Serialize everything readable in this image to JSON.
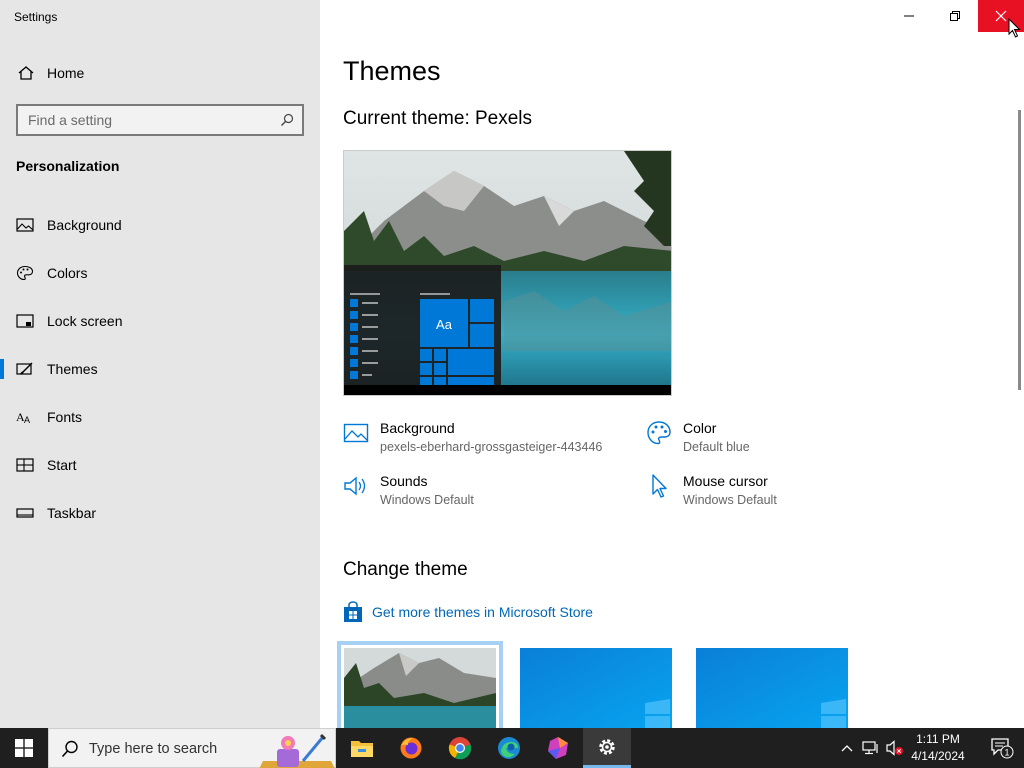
{
  "window": {
    "title": "Settings",
    "minimize_glyph": "—",
    "close_glyph": "✕"
  },
  "sidebar": {
    "home_label": "Home",
    "search_placeholder": "Find a setting",
    "section_title": "Personalization",
    "items": [
      {
        "label": "Background",
        "icon": "picture-icon"
      },
      {
        "label": "Colors",
        "icon": "palette-icon"
      },
      {
        "label": "Lock screen",
        "icon": "lock-screen-icon"
      },
      {
        "label": "Themes",
        "icon": "themes-icon",
        "active": true
      },
      {
        "label": "Fonts",
        "icon": "fonts-icon"
      },
      {
        "label": "Start",
        "icon": "start-icon"
      },
      {
        "label": "Taskbar",
        "icon": "taskbar-icon"
      }
    ]
  },
  "main": {
    "page_title": "Themes",
    "current_theme_label": "Current theme: Pexels",
    "preview_tile_text": "Aa",
    "properties": {
      "background": {
        "name": "Background",
        "value": "pexels-eberhard-grossgasteiger-443446"
      },
      "color": {
        "name": "Color",
        "value": "Default blue"
      },
      "sounds": {
        "name": "Sounds",
        "value": "Windows Default"
      },
      "mouse_cursor": {
        "name": "Mouse cursor",
        "value": "Windows Default"
      }
    },
    "change_theme_title": "Change theme",
    "store_link": "Get more themes in Microsoft Store"
  },
  "taskbar": {
    "search_placeholder": "Type here to search",
    "apps": [
      "file-explorer-icon",
      "firefox-icon",
      "chrome-icon",
      "edge-icon",
      "app-icon",
      "settings-icon"
    ],
    "clock_time": "1:11 PM",
    "clock_date": "4/14/2024",
    "notification_count": "1"
  },
  "colors": {
    "accent": "#0078d7",
    "close_red": "#e81123",
    "link": "#0067b8"
  }
}
